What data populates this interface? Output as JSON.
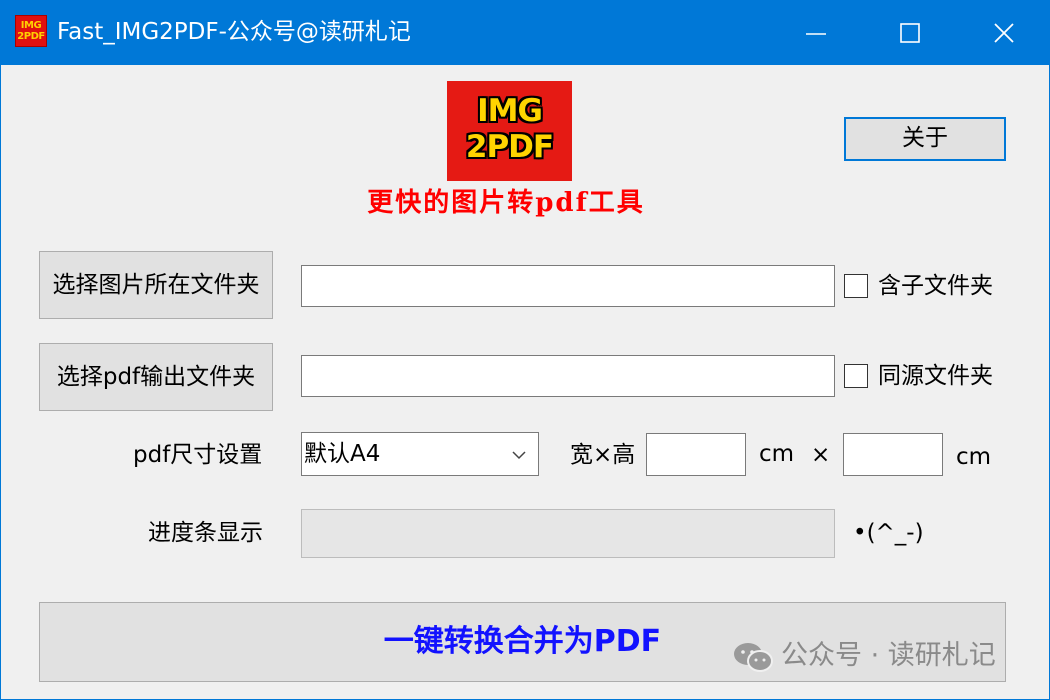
{
  "window": {
    "title": "Fast_IMG2PDF-公众号@读研札记",
    "app_icon_text": "IMG 2PDF",
    "controls": [
      "minimize-icon",
      "maximize-icon",
      "close-icon"
    ]
  },
  "header": {
    "logo_text": "IMG 2PDF",
    "tagline": "更快的图片转pdf工具",
    "about_label": "关于"
  },
  "image_folder": {
    "button_label": "选择图片所在文件夹",
    "path_value": "",
    "checkbox_label": "含子文件夹",
    "checked": false
  },
  "output_folder": {
    "button_label": "选择pdf输出文件夹",
    "path_value": "",
    "checkbox_label": "同源文件夹",
    "checked": false
  },
  "size": {
    "label": "pdf尺寸设置",
    "selected": "默认A4",
    "wh_label": "宽×高",
    "width_value": "",
    "width_unit": "cm",
    "times": "×",
    "height_value": "",
    "height_unit": "cm"
  },
  "progress": {
    "label": "进度条显示",
    "fraction": 0,
    "face": "•(^_-)"
  },
  "convert_label": "一键转换合并为PDF",
  "watermark": "公众号 · 读研札记"
}
